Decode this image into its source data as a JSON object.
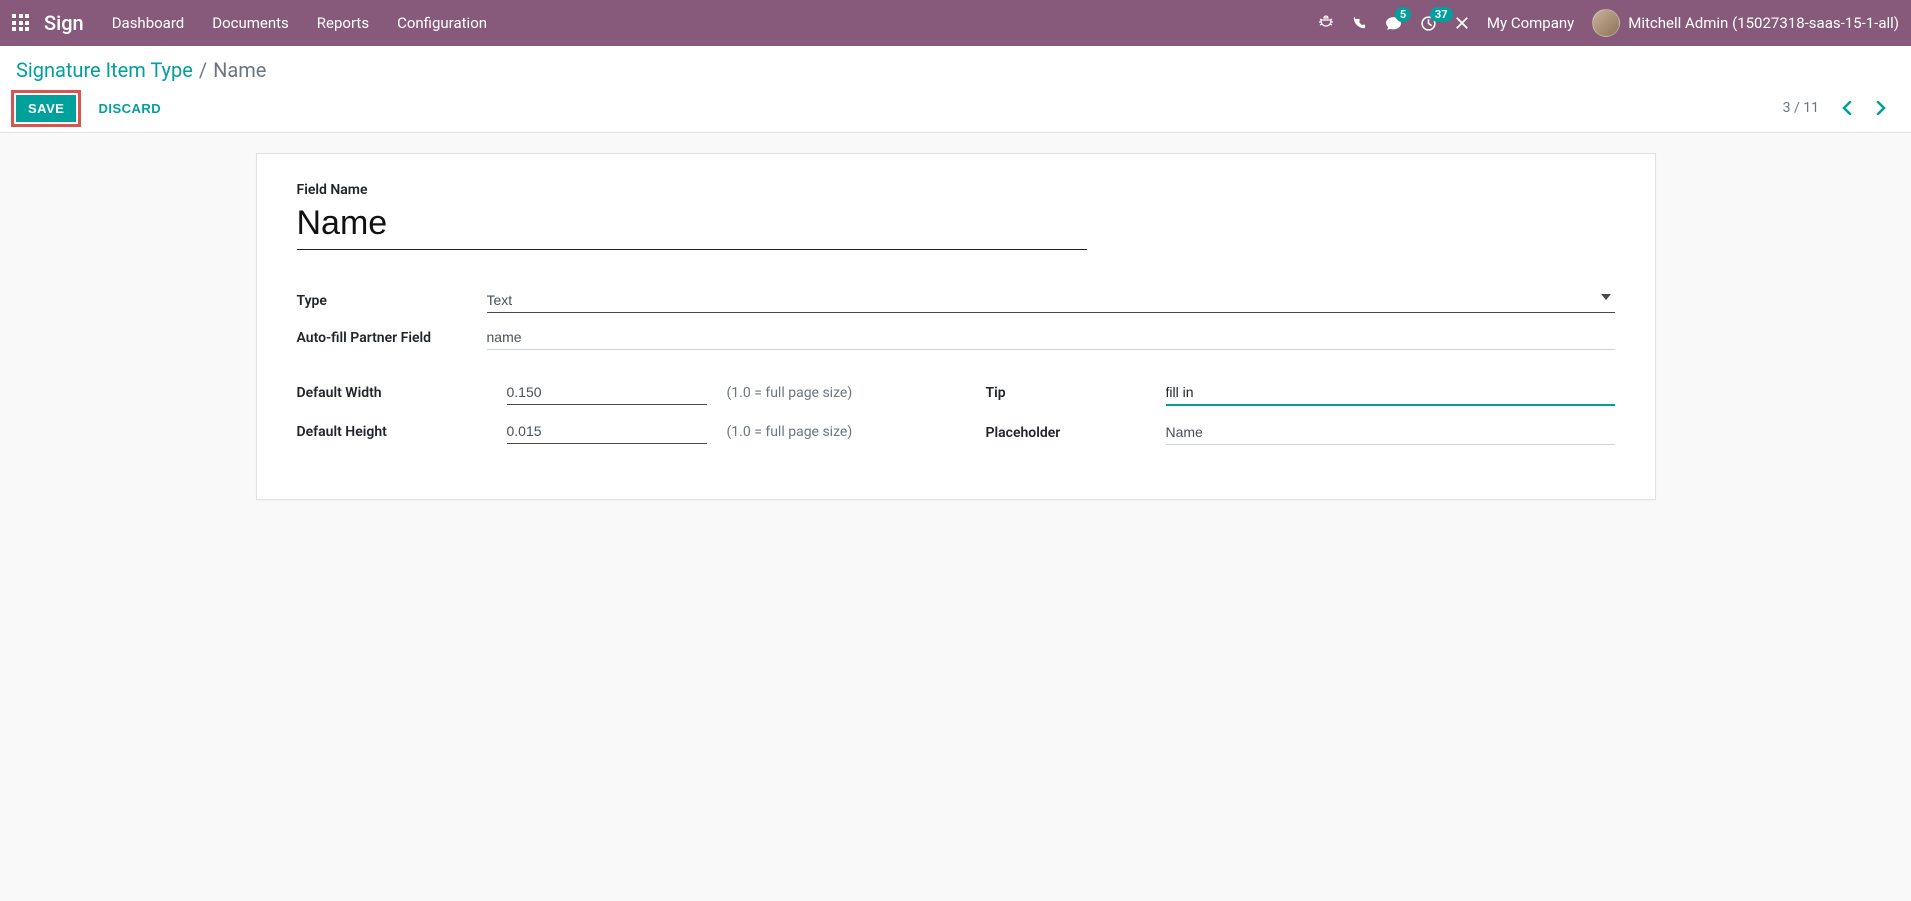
{
  "nav": {
    "brand": "Sign",
    "links": [
      "Dashboard",
      "Documents",
      "Reports",
      "Configuration"
    ],
    "badges": {
      "messages": "5",
      "activities": "37"
    },
    "company": "My Company",
    "user": "Mitchell Admin (15027318-saas-15-1-all)"
  },
  "breadcrumb": {
    "root": "Signature Item Type",
    "current": "Name"
  },
  "buttons": {
    "save": "SAVE",
    "discard": "DISCARD"
  },
  "pager": {
    "text": "3 / 11"
  },
  "form": {
    "field_name_label": "Field Name",
    "field_name_value": "Name",
    "type_label": "Type",
    "type_value": "Text",
    "autofill_label": "Auto-fill Partner Field",
    "autofill_value": "name",
    "default_width_label": "Default Width",
    "default_width_value": "0.150",
    "default_height_label": "Default Height",
    "default_height_value": "0.015",
    "size_hint": "(1.0 = full page size)",
    "tip_label": "Tip",
    "tip_value": "fill in",
    "placeholder_label": "Placeholder",
    "placeholder_value": "Name"
  }
}
